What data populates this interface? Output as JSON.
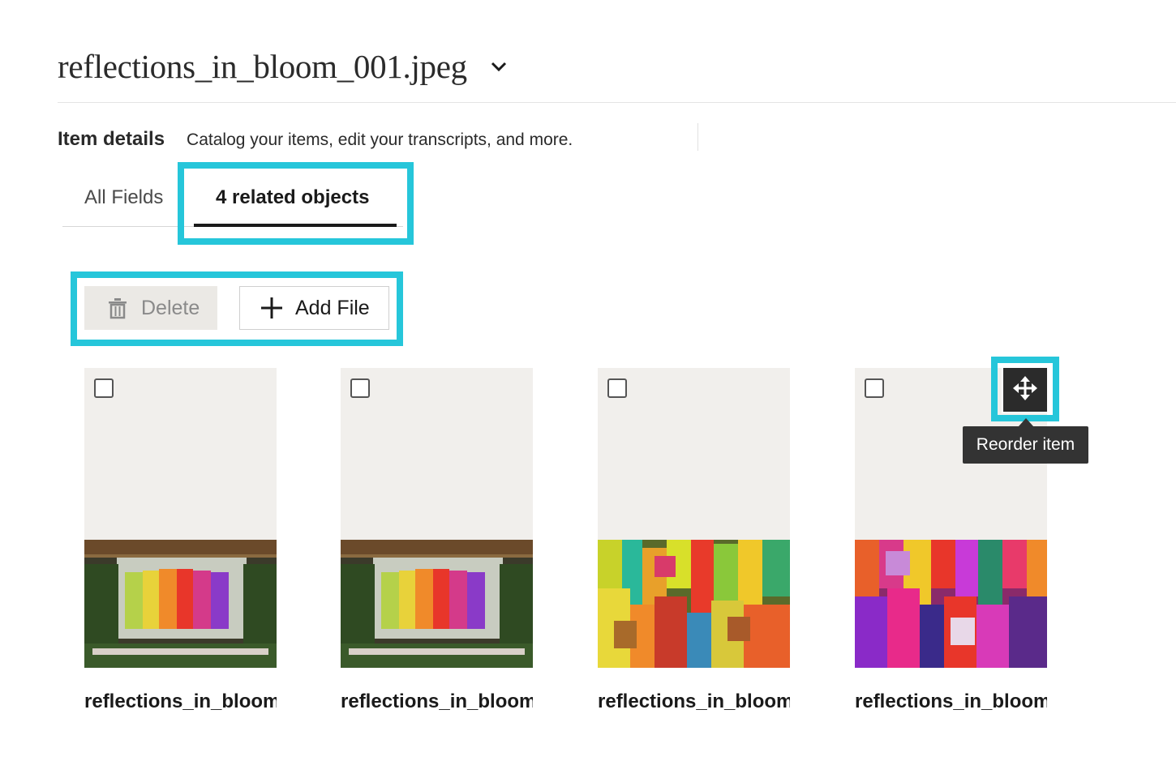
{
  "header": {
    "title": "reflections_in_bloom_001.jpeg",
    "dropdown_icon": "chevron-down-icon"
  },
  "details": {
    "label": "Item details",
    "description": "Catalog your items, edit your transcripts, and more."
  },
  "tabs": [
    {
      "label": "All Fields",
      "active": false
    },
    {
      "label": "4 related objects",
      "active": true
    }
  ],
  "toolbar": {
    "delete_label": "Delete",
    "delete_icon": "trash-icon",
    "delete_enabled": false,
    "add_label": "Add File",
    "add_icon": "plus-icon"
  },
  "cards": [
    {
      "name": "reflections_in_bloom",
      "checked": false
    },
    {
      "name": "reflections_in_bloom",
      "checked": false
    },
    {
      "name": "reflections_in_bloom",
      "checked": false
    },
    {
      "name": "reflections_in_bloom",
      "checked": false
    }
  ],
  "reorder": {
    "icon": "move-icon",
    "tooltip": "Reorder item"
  },
  "colors": {
    "highlight": "#26c6da",
    "card_placeholder": "#f1efec",
    "tooltip_bg": "#333333",
    "delete_bg": "#ebe9e5"
  }
}
